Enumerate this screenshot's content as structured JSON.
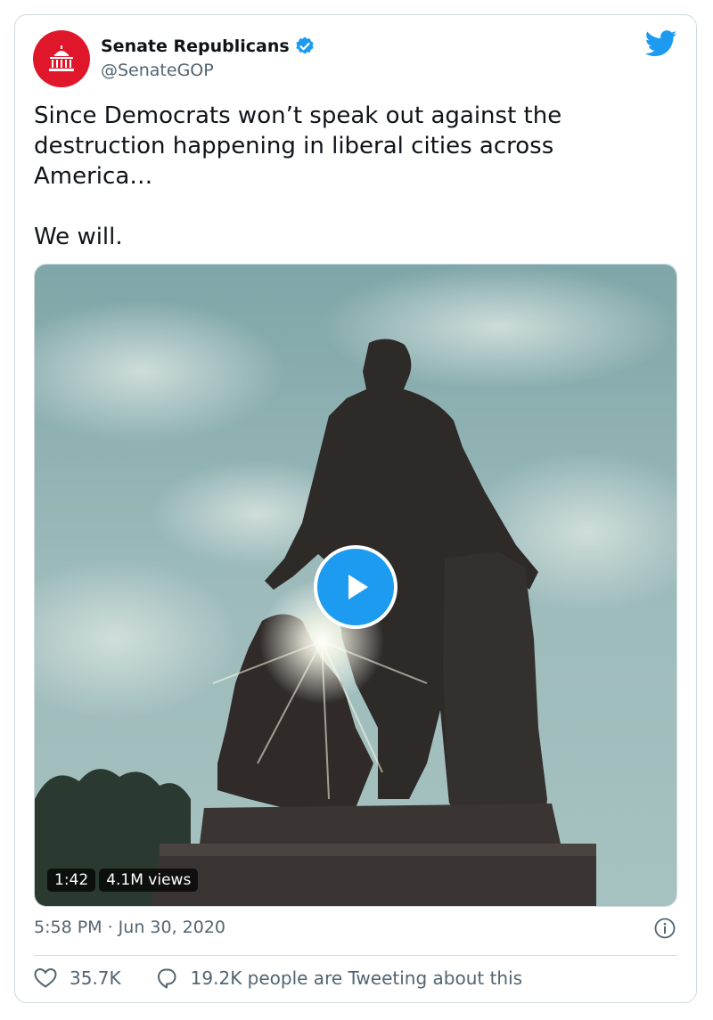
{
  "tweet": {
    "author_name": "Senate Republicans",
    "author_handle": "@SenateGOP",
    "verified": true,
    "text_lines": [
      "Since Democrats won’t speak out against the destruction happening in liberal cities across America…",
      "We will."
    ],
    "video": {
      "duration": "1:42",
      "views": "4.1M views"
    },
    "timestamp": "5:58 PM · Jun 30, 2020",
    "likes": "35.7K",
    "tweeting_about": "19.2K people are Tweeting about this"
  },
  "colors": {
    "brand_blue": "#1d9bf0",
    "avatar_red": "#e0162b",
    "muted_text": "#536471",
    "border": "#cfd9de"
  },
  "icons": [
    "capitol-icon",
    "verified-badge-icon",
    "twitter-bird-icon",
    "play-icon",
    "info-icon",
    "heart-icon",
    "reply-bubble-icon"
  ]
}
